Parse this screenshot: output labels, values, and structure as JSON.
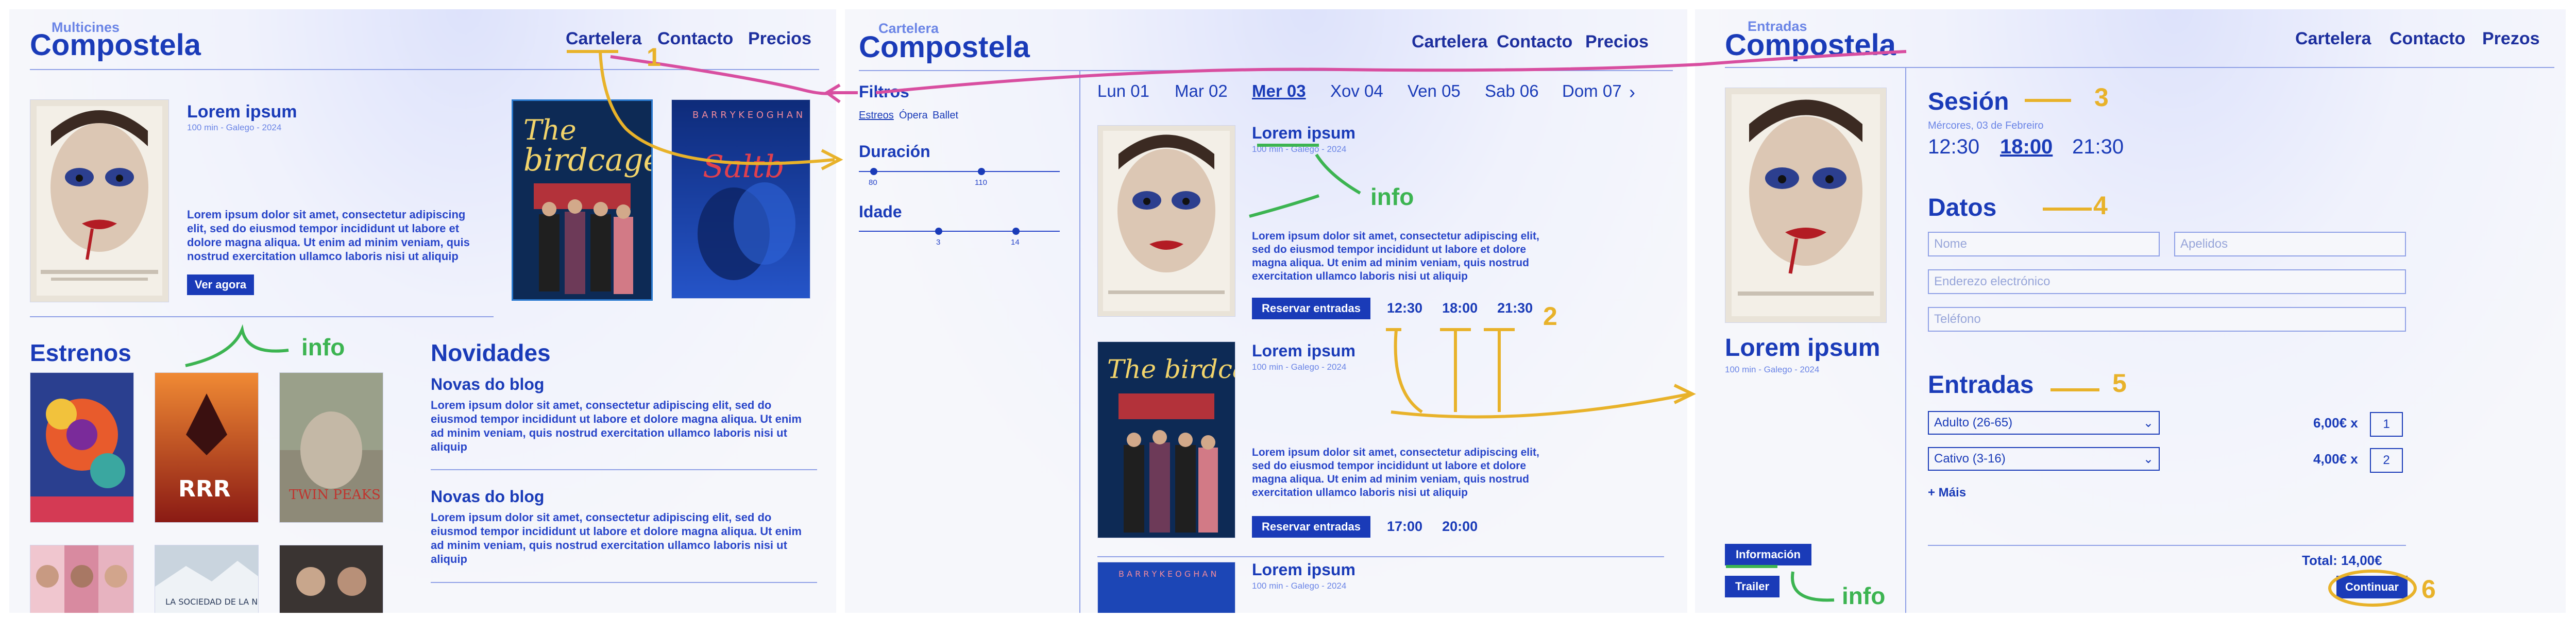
{
  "colors": {
    "brand": "#1a3bb8",
    "accent_annotation_yellow": "#e8b22a",
    "annotation_green": "#3cb451",
    "annotation_magenta": "#d84ea0"
  },
  "screen1": {
    "subtitle": "Multicines",
    "brand": "Compostela",
    "nav": [
      "Cartelera",
      "Contacto",
      "Precios"
    ],
    "featured": {
      "title": "Lorem ipsum",
      "meta": "100 min - Galego - 2024",
      "text": "Lorem ipsum dolor sit amet, consectetur adipiscing elit, sed do eiusmod tempor incididunt ut labore et dolore magna aliqua. Ut enim ad minim veniam, quis nostrud exercitation ullamco laboris nisi ut aliquip",
      "button": "Ver agora"
    },
    "estrenos_title": "Estrenos",
    "novidades_title": "Novidades",
    "blog": [
      {
        "title": "Novas do blog",
        "text": "Lorem ipsum dolor sit amet, consectetur adipiscing elit, sed do eiusmod tempor incididunt ut labore et dolore magna aliqua. Ut enim ad minim veniam, quis nostrud exercitation ullamco laboris nisi ut aliquip"
      },
      {
        "title": "Novas do blog",
        "text": "Lorem ipsum dolor sit amet, consectetur adipiscing elit, sed do eiusmod tempor incididunt ut labore et dolore magna aliqua. Ut enim ad minim veniam, quis nostrud exercitation ullamco laboris nisi ut aliquip"
      }
    ],
    "poster_texts": {
      "birdcage": "The birdcage",
      "rrr": "RRR",
      "twinpeaks": "TWIN PEAKS",
      "sociedad": "LA SOCIEDAD DE LA NIEVE"
    }
  },
  "screen2": {
    "subtitle": "Cartelera",
    "brand": "Compostela",
    "nav": [
      "Cartelera",
      "Contacto",
      "Precios"
    ],
    "filters_title": "Filtros",
    "filter_tags": [
      "Estreos",
      "Ópera",
      "Ballet"
    ],
    "duration_label": "Duración",
    "duration_range": [
      "80",
      "110"
    ],
    "age_label": "Idade",
    "age_range": [
      "3",
      "14"
    ],
    "days": [
      "Lun 01",
      "Mar 02",
      "Mer 03",
      "Xov 04",
      "Ven 05",
      "Sab 06",
      "Dom 07"
    ],
    "next_icon": "›",
    "movies": [
      {
        "title": "Lorem ipsum",
        "meta": "100 min - Galego - 2024",
        "text": "Lorem ipsum dolor sit amet, consectetur adipiscing elit, sed do eiusmod tempor incididunt ut labore et dolore magna aliqua. Ut enim ad minim veniam, quis nostrud exercitation ullamco laboris nisi ut aliquip",
        "button": "Reservar entradas",
        "times": [
          "12:30",
          "18:00",
          "21:30"
        ]
      },
      {
        "title": "Lorem ipsum",
        "meta": "100 min - Galego - 2024",
        "text": "Lorem ipsum dolor sit amet, consectetur adipiscing elit, sed do eiusmod tempor incididunt ut labore et dolore magna aliqua. Ut enim ad minim veniam, quis nostrud exercitation ullamco laboris nisi ut aliquip",
        "button": "Reservar entradas",
        "times": [
          "17:00",
          "20:00"
        ]
      },
      {
        "title": "Lorem ipsum",
        "meta": "100 min - Galego - 2024"
      }
    ]
  },
  "screen3": {
    "subtitle": "Entradas",
    "brand": "Compostela",
    "nav": [
      "Cartelera",
      "Contacto",
      "Prezos"
    ],
    "movie_title": "Lorem ipsum",
    "movie_meta": "100 min - Galego - 2024",
    "info_button": "Información",
    "trailer_button": "Trailer",
    "session_title": "Sesión",
    "session_date": "Mércores, 03 de Febreiro",
    "session_times": [
      "12:30",
      "18:00",
      "21:30"
    ],
    "data_title": "Datos",
    "fields": {
      "nome": "Nome",
      "apelidos": "Apelidos",
      "email": "Enderezo electrónico",
      "phone": "Teléfono"
    },
    "tickets_title": "Entradas",
    "ticket_types": [
      {
        "label": "Adulto (26-65)",
        "price": "6,00€ x",
        "qty": "1"
      },
      {
        "label": "Cativo (3-16)",
        "price": "4,00€ x",
        "qty": "2"
      }
    ],
    "more": "+ Máis",
    "total": "Total: 14,00€",
    "continue": "Continuar"
  },
  "annotations": {
    "n1": "1",
    "n2": "2",
    "n3": "3",
    "n4": "4",
    "n5": "5",
    "n6": "6",
    "info": "info"
  }
}
